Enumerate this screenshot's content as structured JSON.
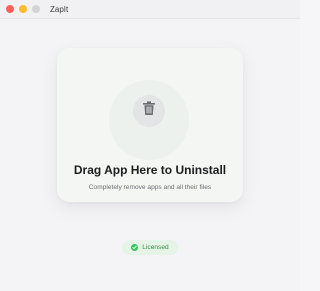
{
  "window": {
    "title": "ZapIt"
  },
  "dropzone": {
    "icon": "trash-icon",
    "headline": "Drag App Here to Uninstall",
    "subline": "Completely remove apps and all their files"
  },
  "license": {
    "label": "Licensed",
    "icon": "checkmark-icon",
    "color": "#34c759"
  },
  "colors": {
    "traffic_red": "#fe5f57",
    "traffic_yellow": "#febc2e",
    "traffic_gray": "#d3d3d6",
    "accent_green": "#34c759"
  }
}
